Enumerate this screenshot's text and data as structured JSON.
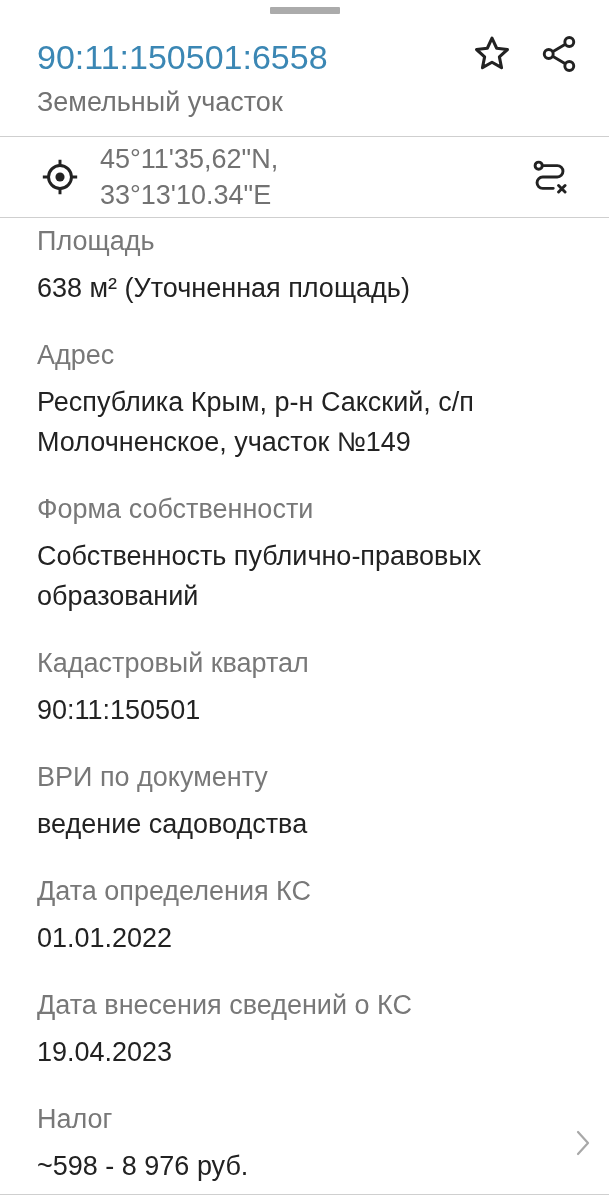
{
  "header": {
    "title": "90:11:150501:6558",
    "subtitle": "Земельный участок"
  },
  "location": {
    "coordinates": "45°11'35,62\"N, 33°13'10.34\"E"
  },
  "fields": [
    {
      "kind": "text",
      "label": "Площадь",
      "value": "638 м² (Уточненная площадь)"
    },
    {
      "kind": "text",
      "label": "Адрес",
      "value": "Республика Крым, р-н Сакский, с/п Молочненское, участок №149"
    },
    {
      "kind": "text",
      "label": "Форма собственности",
      "value": "Собственность публично-правовых образований"
    },
    {
      "kind": "text",
      "label": "Кадастровый квартал",
      "value": "90:11:150501"
    },
    {
      "kind": "text",
      "label": "ВРИ по документу",
      "value": "ведение садоводства"
    },
    {
      "kind": "text",
      "label": "Дата определения КС",
      "value": "01.01.2022"
    },
    {
      "kind": "text",
      "label": "Дата внесения сведений о КС",
      "value": "19.04.2023"
    },
    {
      "kind": "link",
      "label": "Налог",
      "value": "~598 - 8 976 руб."
    }
  ]
}
